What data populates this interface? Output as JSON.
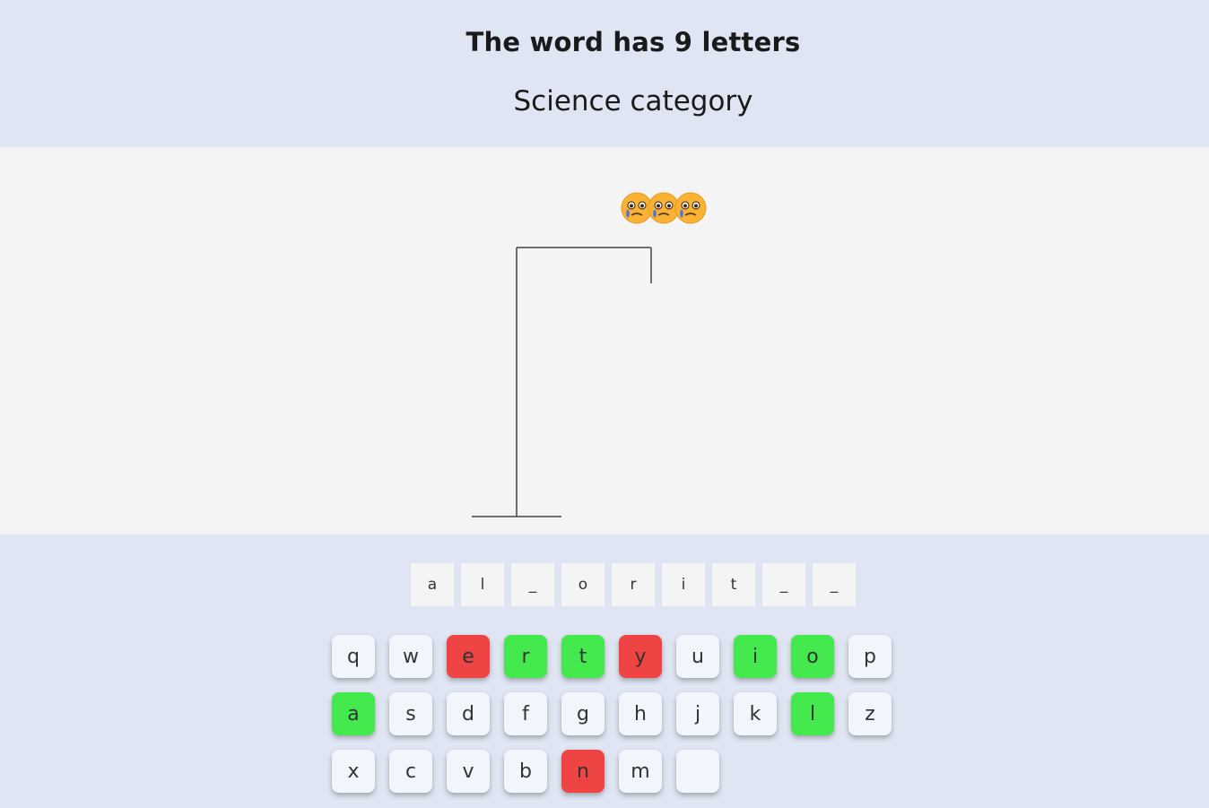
{
  "header": {
    "title": "The word has 9 letters",
    "category": "Science category"
  },
  "lives": {
    "icon": "crying-face-emoji",
    "count": 3
  },
  "word_slots": [
    "a",
    "l",
    "_",
    "o",
    "r",
    "i",
    "t",
    "_",
    "_"
  ],
  "keyboard": {
    "rows": [
      [
        {
          "label": "q",
          "state": "unused"
        },
        {
          "label": "w",
          "state": "unused"
        },
        {
          "label": "e",
          "state": "wrong"
        },
        {
          "label": "r",
          "state": "correct"
        },
        {
          "label": "t",
          "state": "correct"
        },
        {
          "label": "y",
          "state": "wrong"
        },
        {
          "label": "u",
          "state": "unused"
        },
        {
          "label": "i",
          "state": "correct"
        },
        {
          "label": "o",
          "state": "correct"
        },
        {
          "label": "p",
          "state": "unused"
        }
      ],
      [
        {
          "label": "a",
          "state": "correct"
        },
        {
          "label": "s",
          "state": "unused"
        },
        {
          "label": "d",
          "state": "unused"
        },
        {
          "label": "f",
          "state": "unused"
        },
        {
          "label": "g",
          "state": "unused"
        },
        {
          "label": "h",
          "state": "unused"
        },
        {
          "label": "j",
          "state": "unused"
        },
        {
          "label": "k",
          "state": "unused"
        },
        {
          "label": "l",
          "state": "correct"
        },
        {
          "label": "z",
          "state": "unused"
        }
      ],
      [
        {
          "label": "x",
          "state": "unused"
        },
        {
          "label": "c",
          "state": "unused"
        },
        {
          "label": "v",
          "state": "unused"
        },
        {
          "label": "b",
          "state": "unused"
        },
        {
          "label": "n",
          "state": "wrong"
        },
        {
          "label": "m",
          "state": "unused"
        },
        {
          "label": "",
          "state": "unused"
        }
      ]
    ]
  },
  "colors": {
    "correct": "#44ea4d",
    "wrong": "#ef4444",
    "key": "#f1f5fc",
    "background": "#dfe5f2",
    "stage": "#f4f4f4"
  }
}
